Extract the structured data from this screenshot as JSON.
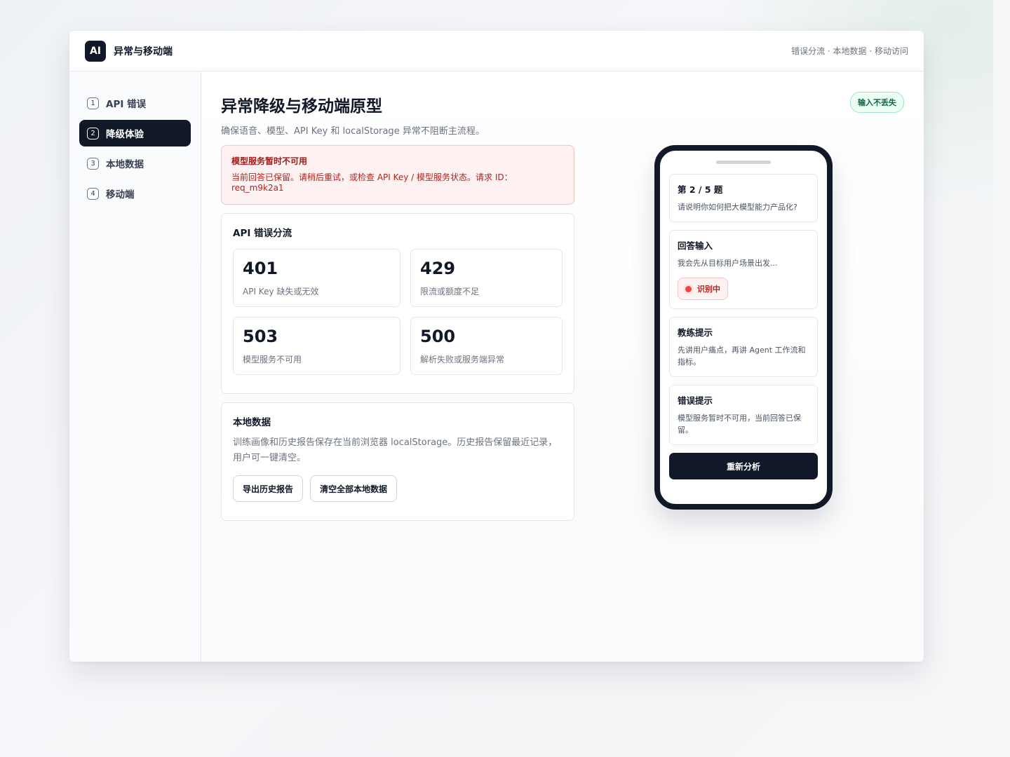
{
  "app": {
    "logo": "AI",
    "name": "异常与移动端",
    "topnav": "错误分流 · 本地数据 · 移动访问"
  },
  "sidebar": {
    "items": [
      {
        "num": "1",
        "label": "API 错误",
        "active": false
      },
      {
        "num": "2",
        "label": "降级体验",
        "active": true
      },
      {
        "num": "3",
        "label": "本地数据",
        "active": false
      },
      {
        "num": "4",
        "label": "移动端",
        "active": false
      }
    ]
  },
  "main": {
    "title": "异常降级与移动端原型",
    "subtitle": "确保语音、模型、API Key 和 localStorage 异常不阻断主流程。",
    "badge": "输入不丢失",
    "alert": {
      "title": "模型服务暂时不可用",
      "text": "当前回答已保留。请稍后重试，或检查 API Key / 模型服务状态。请求 ID：req_m9k2a1"
    },
    "api_errors": {
      "title": "API 错误分流",
      "items": [
        {
          "code": "401",
          "desc": "API Key 缺失或无效"
        },
        {
          "code": "429",
          "desc": "限流或额度不足"
        },
        {
          "code": "503",
          "desc": "模型服务不可用"
        },
        {
          "code": "500",
          "desc": "解析失败或服务端异常"
        }
      ]
    },
    "local_data": {
      "title": "本地数据",
      "text": "训练画像和历史报告保存在当前浏览器 localStorage。历史报告保留最近记录，用户可一键清空。",
      "export_label": "导出历史报告",
      "clear_label": "清空全部本地数据"
    }
  },
  "phone": {
    "question": {
      "title": "第 2 / 5 题",
      "text": "请说明你如何把大模型能力产品化?"
    },
    "answer": {
      "title": "回答输入",
      "text": "我会先从目标用户场景出发...",
      "status": "识别中"
    },
    "coach": {
      "title": "教练提示",
      "text": "先讲用户痛点，再讲 Agent 工作流和指标。"
    },
    "error": {
      "title": "错误提示",
      "text": "模型服务暂时不可用，当前回答已保留。"
    },
    "button_label": "重新分析"
  },
  "colors": {
    "primary": "#111827",
    "danger_bg": "#fef1f1",
    "danger_text": "#b42318",
    "success_bg": "#ecfdf3",
    "success_text": "#15663f"
  }
}
